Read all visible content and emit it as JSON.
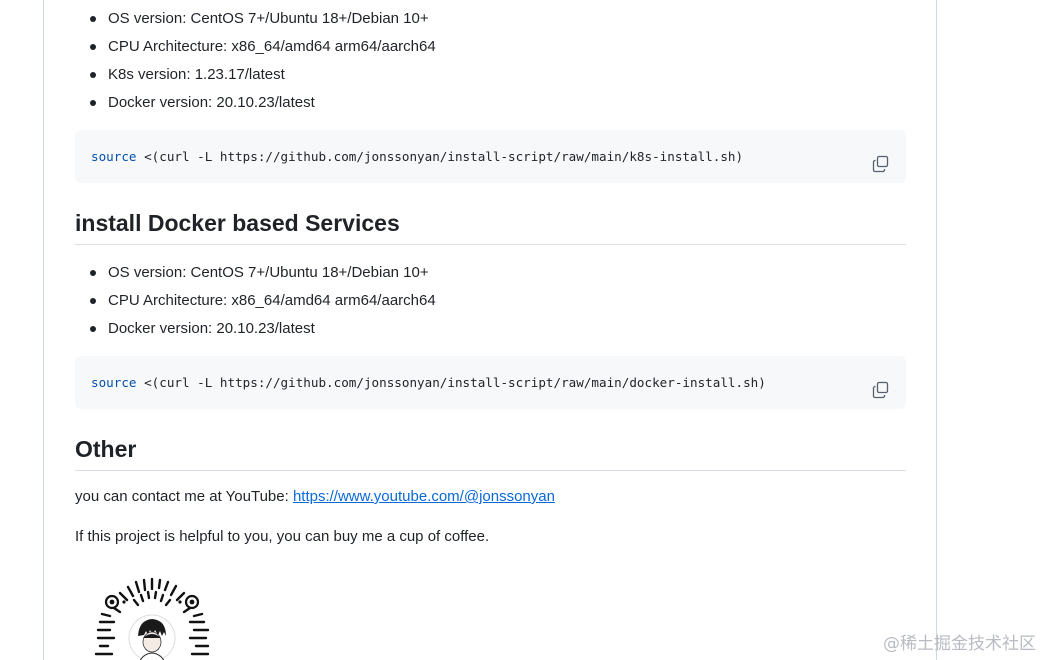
{
  "k8s_section": {
    "requirements": [
      "OS version: CentOS 7+/Ubuntu 18+/Debian 10+",
      "CPU Architecture: x86_64/amd64 arm64/aarch64",
      "K8s version: 1.23.17/latest",
      "Docker version: 20.10.23/latest"
    ],
    "command_keyword": "source",
    "command_rest": " <(curl -L https://github.com/jonssonyan/install-script/raw/main/k8s-install.sh)"
  },
  "docker_section": {
    "title": "install Docker based Services",
    "requirements": [
      "OS version: CentOS 7+/Ubuntu 18+/Debian 10+",
      "CPU Architecture: x86_64/amd64 arm64/aarch64",
      "Docker version: 20.10.23/latest"
    ],
    "command_keyword": "source",
    "command_rest": " <(curl -L https://github.com/jonssonyan/install-script/raw/main/docker-install.sh)"
  },
  "other_section": {
    "title": "Other",
    "contact_text": "you can contact me at YouTube: ",
    "contact_link": "https://www.youtube.com/@jonssonyan",
    "coffee_text": "If this project is helpful to you, you can buy me a cup of coffee."
  },
  "watermark": "@稀土掘金技术社区",
  "icons": {
    "copy": "copy-icon",
    "qr": "qr-code"
  },
  "colors": {
    "link": "#0969da",
    "code_bg": "#f6f8fa",
    "code_keyword": "#0550ae"
  }
}
